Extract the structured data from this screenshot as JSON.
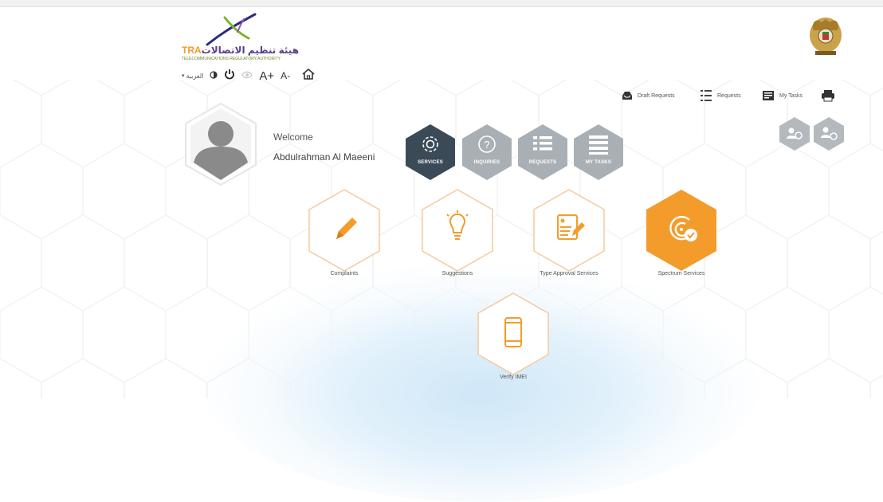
{
  "header": {
    "logo": {
      "brand": "TRA",
      "arabic_name": "هيئة تنظيم الاتصالات",
      "tagline": "TELECOMMUNICATIONS REGULATORY AUTHORITY"
    },
    "emblem_icon": "uae-emblem-icon"
  },
  "toolbar": {
    "language_label": "العربية",
    "font_increase": "A+",
    "font_decrease": "A-",
    "icons": [
      "contrast-icon",
      "power-icon",
      "eye-icon",
      "home-icon"
    ]
  },
  "topnav": {
    "draft_requests": "Draft Requests",
    "requests": "Requests",
    "my_tasks": "My Tasks",
    "icons": [
      "inbox-icon",
      "list-icon",
      "tasks-icon",
      "print-icon"
    ]
  },
  "profile": {
    "welcome": "Welcome",
    "name": "Abdulrahman Al Maeeni"
  },
  "main_menu": [
    {
      "label": "SERVICES",
      "icon": "gear-icon",
      "active": true
    },
    {
      "label": "INQUIRIES",
      "icon": "question-icon",
      "active": false
    },
    {
      "label": "REQUESTS",
      "icon": "list-icon",
      "active": false
    },
    {
      "label": "MY TASKS",
      "icon": "tasks-icon",
      "active": false
    }
  ],
  "services": [
    {
      "label": "Complaints",
      "icon": "pencil-icon"
    },
    {
      "label": "Suggestions",
      "icon": "lightbulb-icon"
    },
    {
      "label": "Type Approval Services",
      "icon": "document-edit-icon"
    },
    {
      "label": "Spectrum Services",
      "icon": "spectrum-check-icon"
    },
    {
      "label": "Verify IMEI",
      "icon": "mobile-phone-icon"
    }
  ],
  "colors": {
    "accent": "#f39c2c",
    "hex_active": "#3b4a57",
    "hex_inactive": "#a9b0b5",
    "hex_border": "#f6c99a"
  }
}
